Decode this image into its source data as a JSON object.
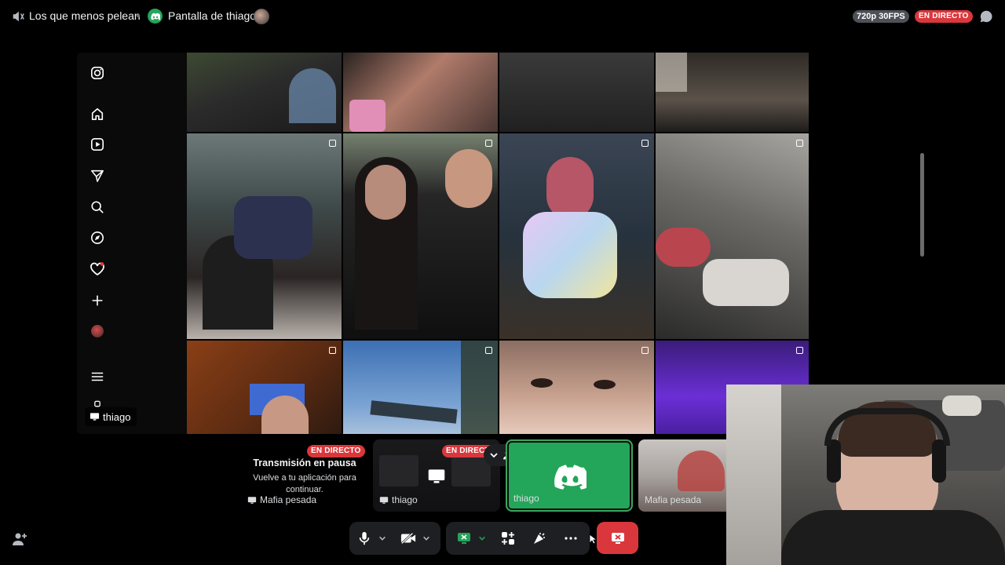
{
  "header": {
    "channel_name": "Los que menos pelean",
    "screen_title": "Pantalla de thiago",
    "quality": "720p 30FPS",
    "live_label": "EN DIRECTO"
  },
  "stream": {
    "owner_name": "thiago"
  },
  "participants": {
    "paused_card": {
      "live_label": "EN DIRECTO",
      "title": "Transmisión en pausa",
      "subtitle": "Vuelve a tu aplicación para continuar.",
      "owner": "Mafia pesada"
    },
    "thumb_stream": {
      "live_label": "EN DIRECTO",
      "owner": "thiago"
    },
    "thumb_thiago": {
      "name": "thiago"
    },
    "thumb_mafia": {
      "name": "Mafia pesada"
    }
  },
  "colors": {
    "live_red": "#da373c",
    "discord_green": "#23a55a",
    "speaking_border": "#3ba55d",
    "panel_dark": "#1e1f22"
  },
  "icons": {
    "header": [
      "speaker-icon",
      "discord-icon",
      "chat-icon"
    ],
    "instagram_sidebar": [
      "instagram-icon",
      "home-icon",
      "reels-icon",
      "send-icon",
      "search-icon",
      "explore-icon",
      "heart-icon",
      "create-icon",
      "profile-icon",
      "menu-icon"
    ],
    "controls": [
      "microphone-icon",
      "camera-off-icon",
      "screen-share-icon",
      "activities-icon",
      "soundboard-icon",
      "more-icon",
      "end-stream-icon"
    ]
  }
}
